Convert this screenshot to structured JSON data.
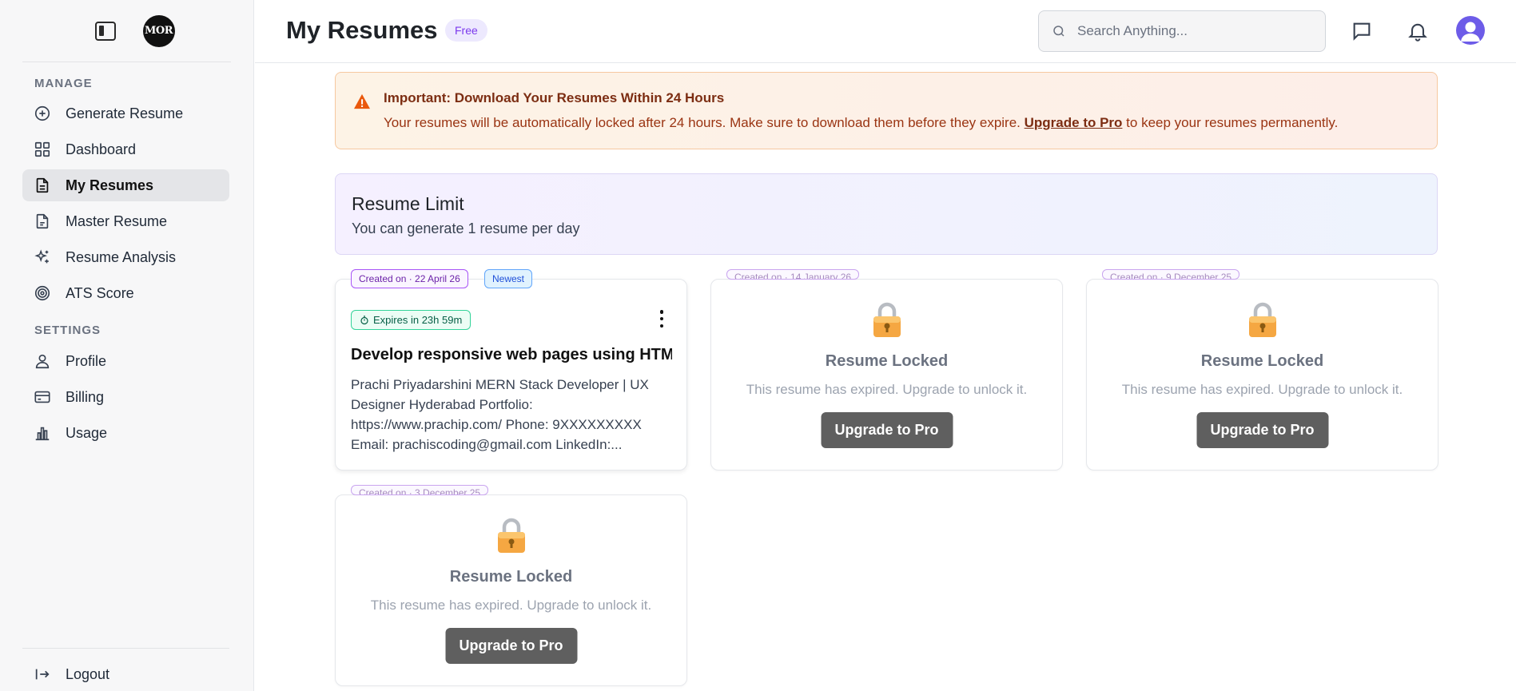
{
  "sidebar": {
    "logo_text": "MOR",
    "manage_label": "MANAGE",
    "settings_label": "SETTINGS",
    "manage_items": [
      {
        "label": "Generate Resume",
        "icon": "plus-circle-icon"
      },
      {
        "label": "Dashboard",
        "icon": "grid-icon"
      },
      {
        "label": "My Resumes",
        "icon": "document-icon",
        "active": true
      },
      {
        "label": "Master Resume",
        "icon": "file-icon"
      },
      {
        "label": "Resume Analysis",
        "icon": "sparkles-icon"
      },
      {
        "label": "ATS Score",
        "icon": "target-icon"
      }
    ],
    "settings_items": [
      {
        "label": "Profile",
        "icon": "user-icon"
      },
      {
        "label": "Billing",
        "icon": "credit-card-icon"
      },
      {
        "label": "Usage",
        "icon": "bar-chart-icon"
      }
    ],
    "logout_label": "Logout"
  },
  "header": {
    "title": "My Resumes",
    "plan_badge": "Free",
    "search_placeholder": "Search Anything..."
  },
  "alert": {
    "title": "Important: Download Your Resumes Within 24 Hours",
    "body_before": "Your resumes will be automatically locked after 24 hours. Make sure to download them before they expire.",
    "link": "Upgrade to Pro",
    "body_after": "to keep your resumes permanently."
  },
  "limit": {
    "title": "Resume Limit",
    "subtitle": "You can generate 1 resume per day"
  },
  "cards": [
    {
      "created": "Created on · 22 April 26",
      "newest": "Newest",
      "expires": "Expires in 23h 59m",
      "title": "Develop responsive web pages using HTML",
      "description": "Prachi Priyadarshini MERN Stack Developer | UX Designer Hyderabad Portfolio: https://www.prachip.com/ Phone: 9XXXXXXXXX Email: prachiscoding@gmail.com LinkedIn:..."
    },
    {
      "created": "Created on · 14 January 26",
      "lock_title": "Resume Locked",
      "lock_subtitle": "This resume has expired. Upgrade to unlock it.",
      "button": "Upgrade to Pro"
    },
    {
      "created": "Created on · 9 December 25",
      "lock_title": "Resume Locked",
      "lock_subtitle": "This resume has expired. Upgrade to unlock it.",
      "button": "Upgrade to Pro"
    },
    {
      "created": "Created on · 3 December 25",
      "lock_title": "Resume Locked",
      "lock_subtitle": "This resume has expired. Upgrade to unlock it.",
      "button": "Upgrade to Pro"
    }
  ],
  "colors": {
    "accent": "#7c3aed",
    "alert_text": "#9a3412",
    "locked_button": "#5f5f5f",
    "avatar": "#6d5ce8"
  }
}
